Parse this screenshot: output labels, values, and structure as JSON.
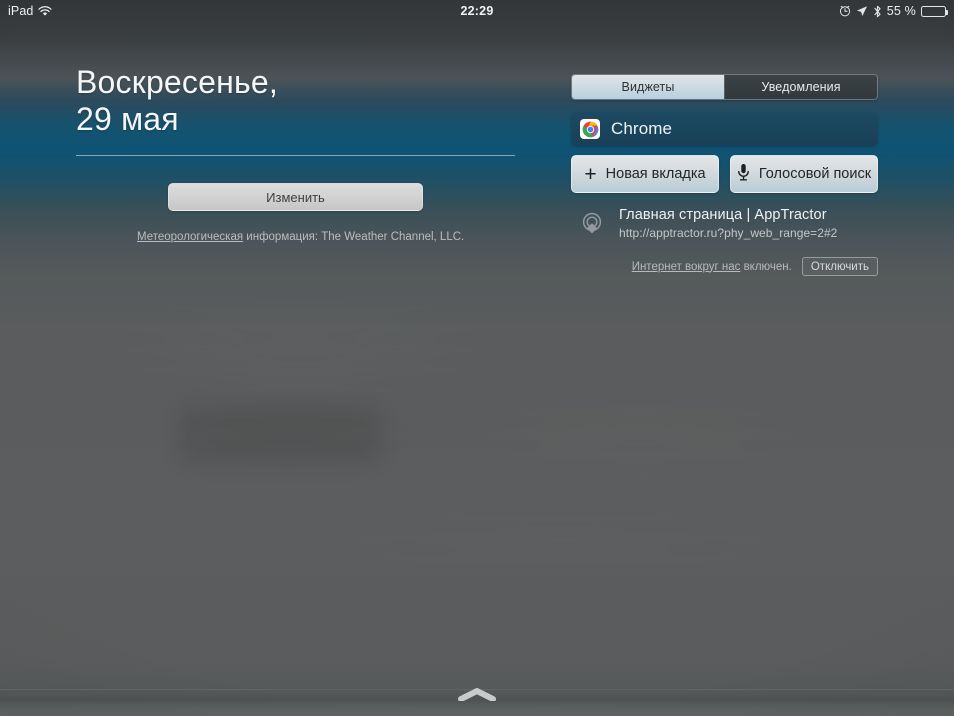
{
  "status_bar": {
    "device_label": "iPad",
    "wifi_icon": "wifi-icon",
    "time": "22:29",
    "alarm_icon": "alarm-clock-icon",
    "location_icon": "location-arrow-icon",
    "bluetooth_icon": "bluetooth-icon",
    "battery_percent": "55 %",
    "battery_level": 55
  },
  "today_view": {
    "date_line_1": "Воскресенье,",
    "date_line_2": "29 мая",
    "edit_button_label": "Изменить",
    "weather_credit_link": "Метеорологическая",
    "weather_credit_rest": " информация: The Weather Channel, LLC."
  },
  "tabs": {
    "widgets_label": "Виджеты",
    "notifications_label": "Уведомления",
    "selected": "Виджеты"
  },
  "chrome_widget": {
    "icon": "chrome-logo-icon",
    "title": "Chrome",
    "new_tab_label": "Новая вкладка",
    "new_tab_icon": "plus-icon",
    "voice_search_label": "Голосовой поиск",
    "voice_search_icon": "microphone-icon",
    "page": {
      "icon": "physical-web-beacon-icon",
      "title": "Главная страница | AppTractor",
      "url": "http://apptractor.ru?phy_web_range=2#2"
    },
    "physical_web": {
      "link_text": "Интернет вокруг нас",
      "status_text": " включен.",
      "disable_button_label": "Отключить"
    }
  },
  "bottom": {
    "grabber_icon": "chevron-up-grabber-icon"
  },
  "colors": {
    "accent_blue": "#0e5375",
    "card_background": "#1a4358",
    "panel_gray": "#5a5c5d",
    "selected_tab": "#cbd9e2"
  }
}
